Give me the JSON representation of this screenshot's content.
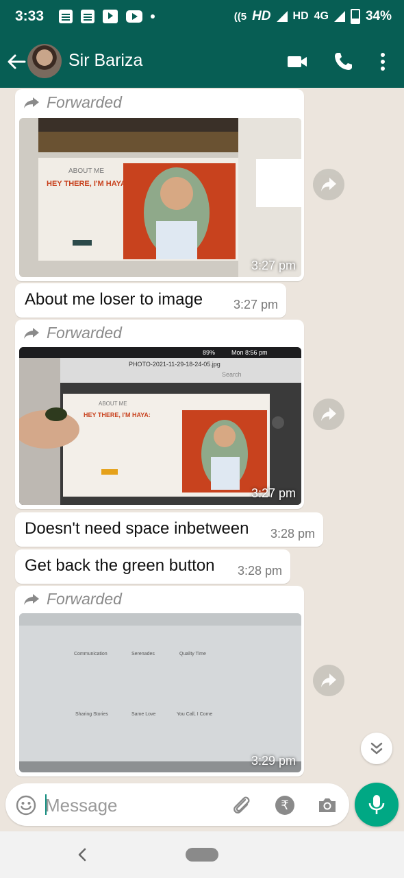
{
  "status_bar": {
    "time": "3:33",
    "network_1": "HD",
    "network_2": "HD",
    "network_3": "4G",
    "battery": "34%",
    "hotspot_count": "5"
  },
  "header": {
    "contact_name": "Sir Bariza",
    "icons": [
      "back-arrow-icon",
      "video-call-icon",
      "voice-call-icon",
      "more-options-icon"
    ]
  },
  "messages": [
    {
      "kind": "image",
      "forwarded_label": "Forwarded",
      "time": "3:27 pm",
      "image_text": {
        "about": "ABOUT ME",
        "headline": "HEY THERE, I'M HAYA!"
      }
    },
    {
      "kind": "text",
      "text": "About me  loser to image",
      "time": "3:27 pm"
    },
    {
      "kind": "image",
      "forwarded_label": "Forwarded",
      "time": "3:27 pm",
      "image_text": {
        "about": "ABOUT ME",
        "headline": "HEY THERE, I'M HAYA:",
        "menubar_time": "Mon 8:56 pm",
        "battery": "89%",
        "file": "PHOTO-2021-11-29-18-24-05.jpg",
        "search": "Search"
      }
    },
    {
      "kind": "text",
      "text": "Doesn't need space inbetween",
      "time": "3:28 pm"
    },
    {
      "kind": "text",
      "text": "Get back the green button",
      "time": "3:28 pm"
    },
    {
      "kind": "image",
      "forwarded_label": "Forwarded",
      "time": "3:29 pm",
      "image_text": {
        "col1": "Communication",
        "col2": "Serenades",
        "col3": "Quality Time",
        "col4": "Sharing Stories",
        "col5": "Same Love",
        "col6": "You Call, I Come"
      }
    }
  ],
  "composer": {
    "placeholder": "Message",
    "icons": [
      "emoji-icon",
      "attach-icon",
      "rupee-payment-icon",
      "camera-icon",
      "mic-icon"
    ]
  },
  "colors": {
    "header": "#075e54",
    "chat_bg": "#ece5dd",
    "accent": "#00a884"
  }
}
